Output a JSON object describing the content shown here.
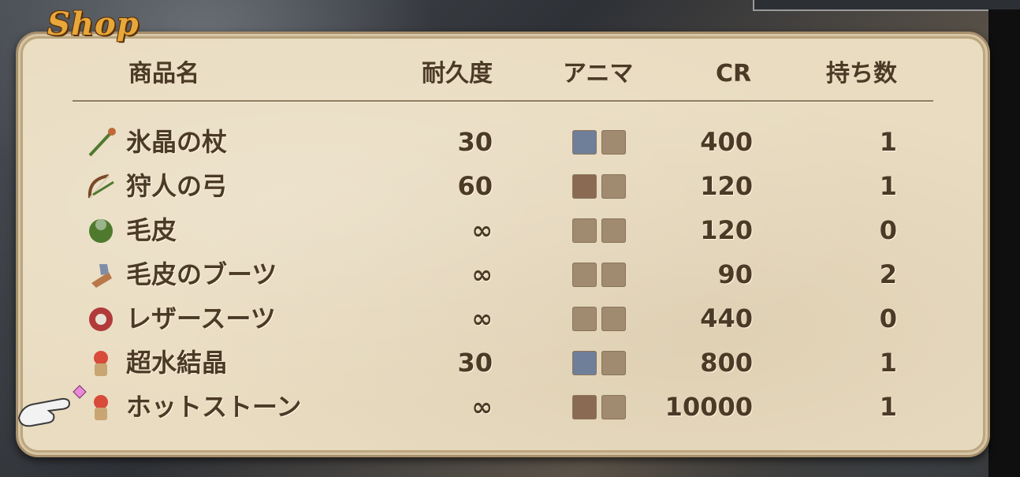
{
  "shop_title": "Shop",
  "columns": {
    "name": "商品名",
    "durability": "耐久度",
    "anima": "アニマ",
    "cr": "CR",
    "owned": "持ち数"
  },
  "items": [
    {
      "name": "氷晶の杖",
      "durability": "30",
      "cr": "400",
      "owned": "1",
      "icon": "staff-icon",
      "anima": [
        "ice",
        "empty"
      ]
    },
    {
      "name": "狩人の弓",
      "durability": "60",
      "cr": "120",
      "owned": "1",
      "icon": "bow-icon",
      "anima": [
        "fire",
        "empty"
      ]
    },
    {
      "name": "毛皮",
      "durability": "∞",
      "cr": "120",
      "owned": "0",
      "icon": "fur-icon",
      "anima": [
        "empty",
        "empty"
      ]
    },
    {
      "name": "毛皮のブーツ",
      "durability": "∞",
      "cr": "90",
      "owned": "2",
      "icon": "boots-icon",
      "anima": [
        "empty",
        "empty"
      ]
    },
    {
      "name": "レザースーツ",
      "durability": "∞",
      "cr": "440",
      "owned": "0",
      "icon": "armor-icon",
      "anima": [
        "empty",
        "empty"
      ]
    },
    {
      "name": "超水結晶",
      "durability": "30",
      "cr": "800",
      "owned": "1",
      "icon": "potion-icon",
      "anima": [
        "ice",
        "empty"
      ]
    },
    {
      "name": "ホットストーン",
      "durability": "∞",
      "cr": "10000",
      "owned": "1",
      "icon": "potion-icon",
      "anima": [
        "fire",
        "empty"
      ]
    }
  ]
}
